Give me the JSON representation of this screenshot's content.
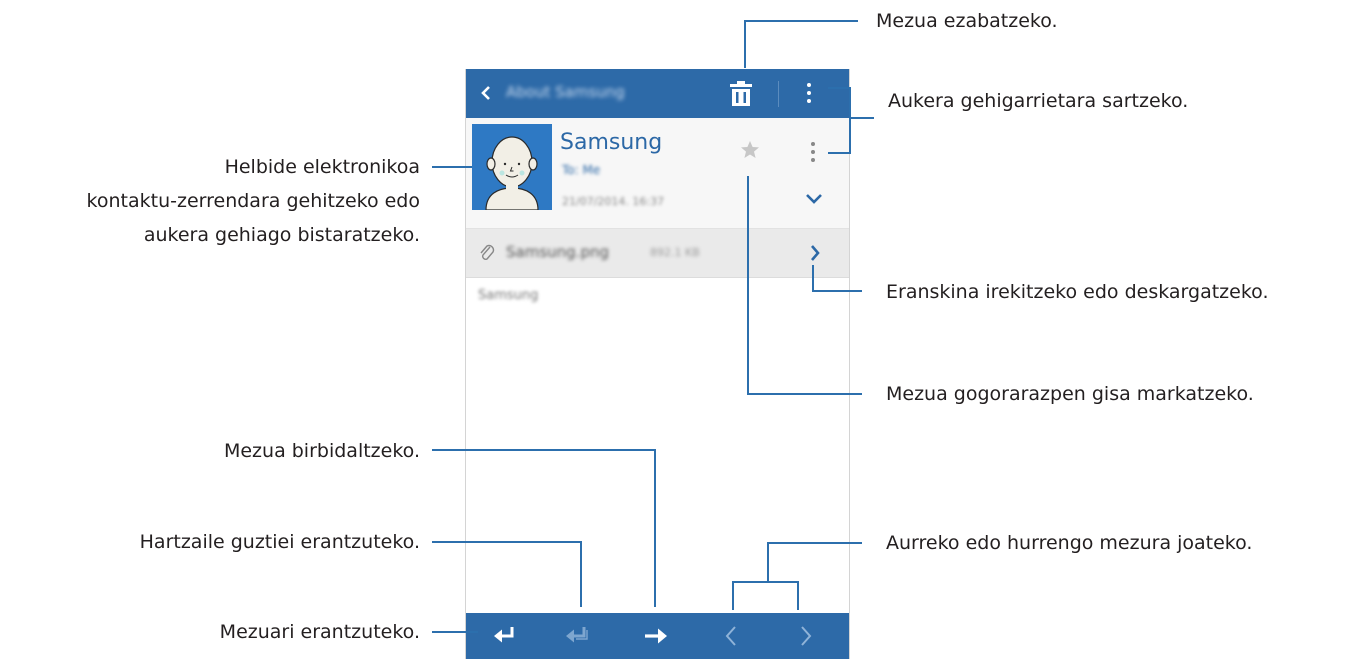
{
  "app_bar": {
    "title": "About Samsung",
    "back_icon": "chevron-left-icon",
    "delete_icon": "trash-icon",
    "more_icon": "more-options-icon"
  },
  "sender": {
    "name": "Samsung",
    "to": "To: Me",
    "date": "21/07/2014. 16:37",
    "star_icon": "star-icon",
    "more_icon": "more-options-icon",
    "expand_icon": "chevron-down-icon"
  },
  "attachment": {
    "file_name": "Samsung.png",
    "file_size": "892.1 KB",
    "open_icon": "chevron-right-icon"
  },
  "message": {
    "body": "Samsung"
  },
  "bottom_bar": {
    "reply_icon": "reply-icon",
    "reply_all_icon": "reply-all-icon",
    "forward_icon": "forward-icon",
    "previous_icon": "chevron-left-icon",
    "next_icon": "chevron-right-icon"
  },
  "colors": {
    "accent": "#2d6aa8",
    "callout_line": "#2c6fad"
  },
  "callouts": {
    "delete": "Mezua ezabatzeko.",
    "more_options": "Aukera gehigarrietara sartzeko.",
    "contact_line1": "Helbide elektronikoa",
    "contact_line2": "kontaktu-zerrendara gehitzeko edo",
    "contact_line3": "aukera gehiago bistaratzeko.",
    "attachment": "Eranskina irekitzeko edo deskargatzeko.",
    "reminder": "Mezua gogorarazpen gisa markatzeko.",
    "forward": "Mezua birbidaltzeko.",
    "reply_all": "Hartzaile guztiei erantzuteko.",
    "navigate": "Aurreko edo hurrengo mezura joateko.",
    "reply": "Mezuari erantzuteko."
  }
}
